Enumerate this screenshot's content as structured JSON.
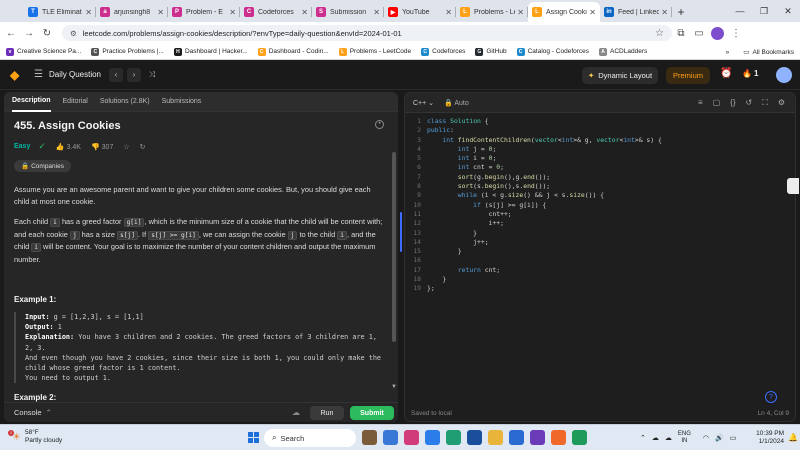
{
  "browser": {
    "tabs": [
      {
        "title": "TLE Eliminat",
        "color": "#1a73e8",
        "glyph": "T"
      },
      {
        "title": "arjunsingh8",
        "color": "#cc2f8d",
        "glyph": "a"
      },
      {
        "title": "Problem - E",
        "color": "#cc2f8d",
        "glyph": "P"
      },
      {
        "title": "Codeforces",
        "color": "#cc2f8d",
        "glyph": "C"
      },
      {
        "title": "Submission",
        "color": "#cc2f8d",
        "glyph": "S"
      },
      {
        "title": "YouTube",
        "color": "#ff0000",
        "glyph": "▶"
      },
      {
        "title": "Problems - Le",
        "color": "#ffa116",
        "glyph": "L"
      },
      {
        "title": "Assign Cooki",
        "color": "#ffa116",
        "glyph": "L"
      },
      {
        "title": "Feed | Linked",
        "color": "#0a66c2",
        "glyph": "in"
      }
    ],
    "new_tab": "+",
    "url": "leetcode.com/problems/assign-cookies/description/?envType=daily-question&envId=2024-01-01",
    "bookmarks": [
      {
        "label": "Creative Science Pa...",
        "color": "#6c2eb9",
        "glyph": "v"
      },
      {
        "label": "Practice Problems |...",
        "color": "#555555",
        "glyph": "C"
      },
      {
        "label": "Dashboard | Hacker...",
        "color": "#1b1b1b",
        "glyph": "H"
      },
      {
        "label": "Dashboard - Codin...",
        "color": "#ffa116",
        "glyph": "C"
      },
      {
        "label": "Problems - LeetCode",
        "color": "#ffa116",
        "glyph": "L"
      },
      {
        "label": "Codeforces",
        "color": "#1f8acb",
        "glyph": "C"
      },
      {
        "label": "GitHub",
        "color": "#24292f",
        "glyph": "G"
      },
      {
        "label": "Catalog - Codeforces",
        "color": "#1f8acb",
        "glyph": "C"
      },
      {
        "label": "ACDLadders",
        "color": "#888888",
        "glyph": "A"
      }
    ],
    "bookmarks_more": "»",
    "all_bookmarks": "All Bookmarks"
  },
  "lc": {
    "daily_question": "Daily Question",
    "dynamic_layout": "Dynamic Layout",
    "premium": "Premium",
    "streak": "1"
  },
  "problem": {
    "tabs": [
      "Description",
      "Editorial",
      "Solutions (2.8K)",
      "Submissions"
    ],
    "title": "455. Assign Cookies",
    "difficulty": "Easy",
    "likes": "3.4K",
    "dislikes": "307",
    "companies": "Companies",
    "para1": "Assume you are an awesome parent and want to give your children some cookies. But, you should give each child at most one cookie.",
    "p2": {
      "a": "Each child ",
      "c1": "i",
      "b": " has a greed factor ",
      "c2": "g[i]",
      "c": ", which is the minimum size of a cookie that the child will be content with; and each cookie ",
      "c3": "j",
      "d": " has a size ",
      "c4": "s[j]",
      "e": ". If ",
      "c5": "s[j] >= g[i]",
      "f": ", we can assign the cookie ",
      "c6": "j",
      "g": " to the child ",
      "c7": "i",
      "h": ", and the child ",
      "c8": "i",
      "k": " will be content. Your goal is to maximize the number of your content children and output the maximum number."
    },
    "example1_title": "Example 1:",
    "example1": {
      "input_label": "Input:",
      "input": " g = [1,2,3], s = [1,1]",
      "output_label": "Output:",
      "output": " 1",
      "explanation_label": "Explanation:",
      "explanation": " You have 3 children and 2 cookies. The greed factors of 3 children are 1, 2, 3.",
      "line2": "And even though you have 2 cookies, since their size is both 1, you could only make the child whose greed factor is 1 content.",
      "line3": "You need to output 1."
    },
    "example2_title": "Example 2:"
  },
  "console": {
    "label": "Console",
    "run": "Run",
    "submit": "Submit"
  },
  "editor": {
    "language": "C++",
    "mode": "Auto",
    "lines": [
      "1",
      "2",
      "3",
      "4",
      "5",
      "6",
      "7",
      "8",
      "9",
      "10",
      "11",
      "12",
      "13",
      "14",
      "15",
      "16",
      "17",
      "18",
      "19"
    ],
    "saved": "Saved to local",
    "position": "Ln 4, Col 9"
  },
  "taskbar": {
    "temp": "58°F",
    "weather": "Partly cloudy",
    "search": "Search",
    "lang1": "ENG",
    "lang2": "IN",
    "time": "10:39 PM",
    "date": "1/1/2024"
  }
}
